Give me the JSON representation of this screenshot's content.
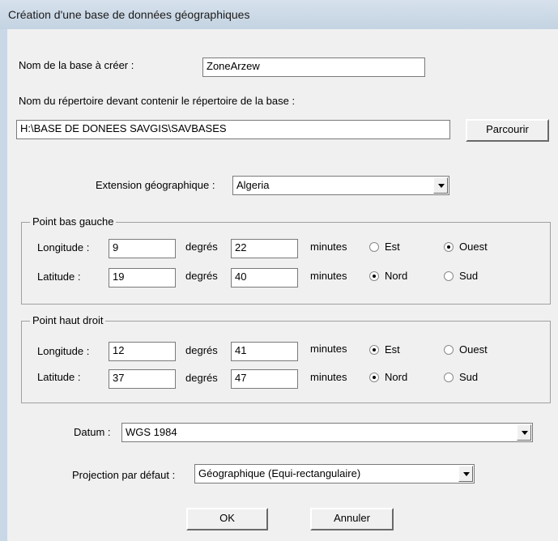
{
  "window": {
    "title": "Création d'une base de données géographiques"
  },
  "form": {
    "db_name_label": "Nom de la base à créer :",
    "db_name_value": "ZoneArzew",
    "dir_label": "Nom du répertoire devant contenir le répertoire de la base :",
    "dir_value": "H:\\BASE DE DONEES SAVGIS\\SAVBASES",
    "browse_label": "Parcourir",
    "extension_label": "Extension géographique :",
    "extension_value": "Algeria",
    "datum_label": "Datum :",
    "datum_value": "WGS 1984",
    "projection_label": "Projection par défaut :",
    "projection_value": "Géographique (Equi-rectangulaire)",
    "ok_label": "OK",
    "cancel_label": "Annuler"
  },
  "units": {
    "degrees": "degrés",
    "minutes": "minutes"
  },
  "directions": {
    "east": "Est",
    "west": "Ouest",
    "north": "Nord",
    "south": "Sud"
  },
  "bottom_left": {
    "title": "Point bas gauche",
    "longitude": {
      "label": "Longitude :",
      "degrees": "9",
      "minutes": "22",
      "selected": "Ouest"
    },
    "latitude": {
      "label": "Latitude :",
      "degrees": "19",
      "minutes": "40",
      "selected": "Nord"
    }
  },
  "top_right": {
    "title": "Point haut droit",
    "longitude": {
      "label": "Longitude :",
      "degrees": "12",
      "minutes": "41",
      "selected": "Est"
    },
    "latitude": {
      "label": "Latitude :",
      "degrees": "37",
      "minutes": "47",
      "selected": "Nord"
    }
  }
}
